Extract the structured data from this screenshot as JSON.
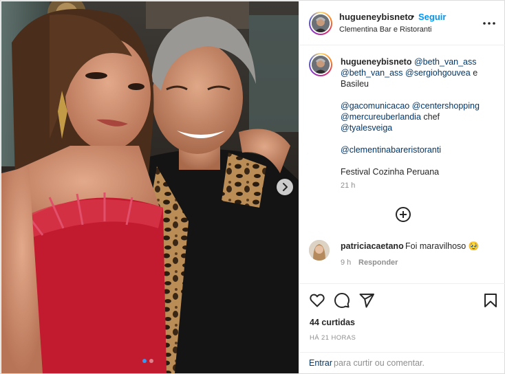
{
  "post_header": {
    "username": "hugueneybisneto",
    "separator": "•",
    "follow_label": "Seguir",
    "location": "Clementina Bar e Ristoranti"
  },
  "caption": {
    "username": "hugueneybisneto",
    "line1": "@beth_van_ass",
    "line2": "@beth_van_ass",
    "line2b": "@sergiohgouvea",
    "line2c": "e",
    "line3": "Basileu",
    "line4a": "@gacomunicacao",
    "line4b": "@centershopping",
    "line5a": "@mercureuberlandia",
    "line5b": "chef",
    "line6": "@tyalesveiga",
    "line7": "@clementinabareristoranti",
    "line8": "Festival Cozinha Peruana",
    "time": "21 h"
  },
  "comment": {
    "username": "patriciacaetano",
    "text": "Foi maravilhoso 🥹",
    "time": "9 h",
    "reply_label": "Responder"
  },
  "engagement": {
    "likes": "44 curtidas",
    "date": "HÁ 21 HORAS"
  },
  "comment_box": {
    "login_label": "Entrar",
    "rest": "para curtir ou comentar."
  },
  "icons": {
    "like": "heart-icon",
    "comment": "comment-icon",
    "share": "share-icon",
    "save": "bookmark-icon",
    "more": "more-icon",
    "next": "chevron-right-icon",
    "load_more": "plus-circle-icon"
  },
  "carousel": {
    "slides": 2,
    "active": 1
  },
  "colors": {
    "link": "#00376b",
    "follow": "#0095f6",
    "muted": "#8e8e8e",
    "dress": "#c21a2e"
  }
}
